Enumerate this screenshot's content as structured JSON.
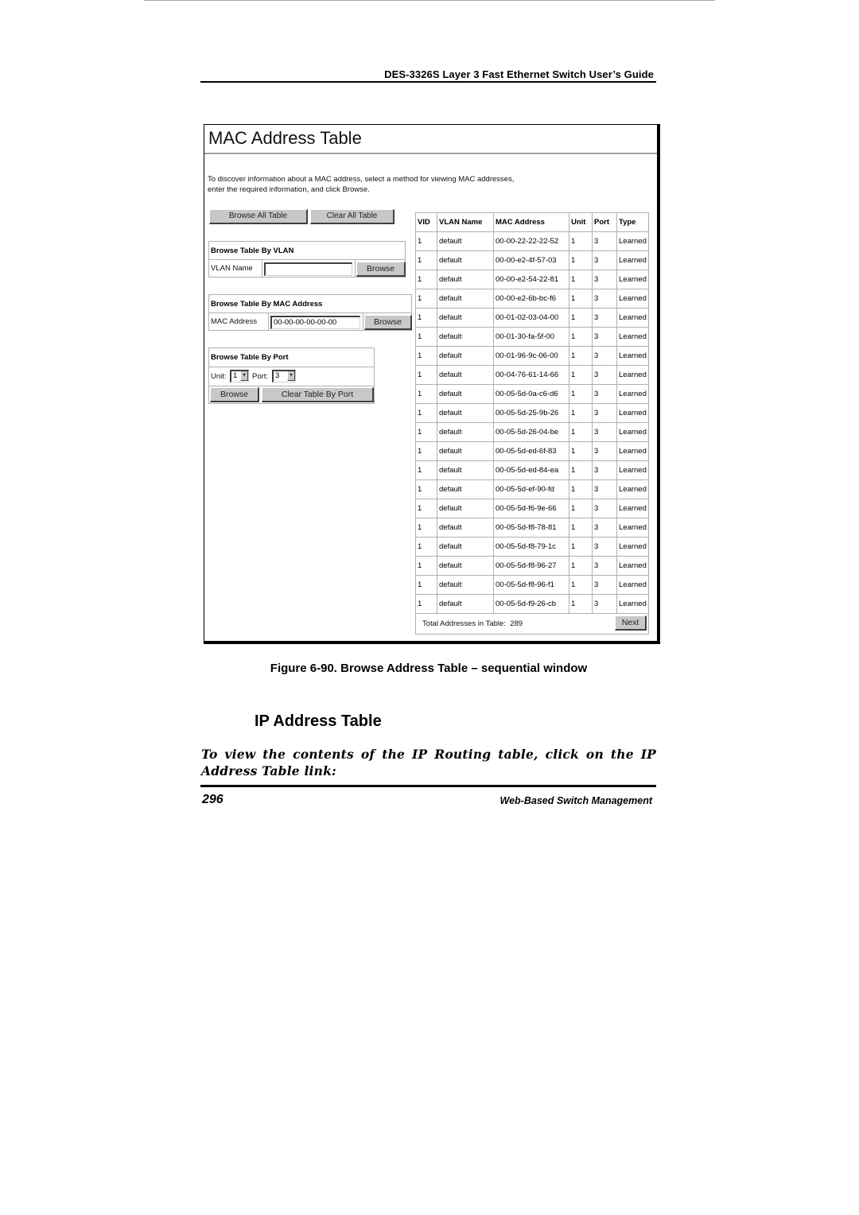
{
  "page": {
    "header_title": "DES-3326S Layer 3 Fast Ethernet Switch User’s Guide",
    "figure_caption": "Figure 6-90.  Browse Address Table – sequential window",
    "section_heading": "IP Address Table",
    "body_text": "To view the contents of the IP Routing table, click on the IP Address Table link:",
    "page_number": "296",
    "footer_title": "Web-Based Switch Management"
  },
  "screen": {
    "title": "MAC Address Table",
    "intro_line1": "To discover information about a MAC address, select a method for viewing MAC addresses,",
    "intro_line2": "enter the required information, and click Browse.",
    "browse_all_label": "Browse All Table",
    "clear_all_label": "Clear All Table",
    "by_vlan": {
      "heading": "Browse Table By VLAN",
      "field_label": "VLAN Name",
      "value": "",
      "button": "Browse"
    },
    "by_mac": {
      "heading": "Browse Table By MAC Address",
      "field_label": "MAC Address",
      "value": "00-00-00-00-00-00",
      "button": "Browse"
    },
    "by_port": {
      "heading": "Browse Table By Port",
      "unit_label": "Unit:",
      "unit_value": "1",
      "port_label": "Port:",
      "port_value": "3",
      "browse_button": "Browse",
      "clear_button": "Clear Table By Port"
    },
    "table": {
      "columns": [
        "VID",
        "VLAN Name",
        "MAC Address",
        "Unit",
        "Port",
        "Type"
      ],
      "rows": [
        [
          "1",
          "default",
          "00-00-22-22-22-52",
          "1",
          "3",
          "Learned"
        ],
        [
          "1",
          "default",
          "00-00-e2-4f-57-03",
          "1",
          "3",
          "Learned"
        ],
        [
          "1",
          "default",
          "00-00-e2-54-22-81",
          "1",
          "3",
          "Learned"
        ],
        [
          "1",
          "default",
          "00-00-e2-6b-bc-f6",
          "1",
          "3",
          "Learned"
        ],
        [
          "1",
          "default",
          "00-01-02-03-04-00",
          "1",
          "3",
          "Learned"
        ],
        [
          "1",
          "default",
          "00-01-30-fa-5f-00",
          "1",
          "3",
          "Learned"
        ],
        [
          "1",
          "default",
          "00-01-96-9c-06-00",
          "1",
          "3",
          "Learned"
        ],
        [
          "1",
          "default",
          "00-04-76-61-14-66",
          "1",
          "3",
          "Learned"
        ],
        [
          "1",
          "default",
          "00-05-5d-0a-c6-d6",
          "1",
          "3",
          "Learned"
        ],
        [
          "1",
          "default",
          "00-05-5d-25-9b-26",
          "1",
          "3",
          "Learned"
        ],
        [
          "1",
          "default",
          "00-05-5d-26-04-be",
          "1",
          "3",
          "Learned"
        ],
        [
          "1",
          "default",
          "00-05-5d-ed-6f-83",
          "1",
          "3",
          "Learned"
        ],
        [
          "1",
          "default",
          "00-05-5d-ed-84-ea",
          "1",
          "3",
          "Learned"
        ],
        [
          "1",
          "default",
          "00-05-5d-ef-90-fd",
          "1",
          "3",
          "Learned"
        ],
        [
          "1",
          "default",
          "00-05-5d-f6-9e-66",
          "1",
          "3",
          "Learned"
        ],
        [
          "1",
          "default",
          "00-05-5d-f8-78-81",
          "1",
          "3",
          "Learned"
        ],
        [
          "1",
          "default",
          "00-05-5d-f8-79-1c",
          "1",
          "3",
          "Learned"
        ],
        [
          "1",
          "default",
          "00-05-5d-f8-96-27",
          "1",
          "3",
          "Learned"
        ],
        [
          "1",
          "default",
          "00-05-5d-f8-96-f1",
          "1",
          "3",
          "Learned"
        ],
        [
          "1",
          "default",
          "00-05-5d-f9-26-cb",
          "1",
          "3",
          "Learned"
        ]
      ],
      "total_label": "Total Addresses in Table:",
      "total_value": "289",
      "next_label": "Next"
    },
    "icons": {
      "dropdown_arrow": "▾"
    }
  }
}
